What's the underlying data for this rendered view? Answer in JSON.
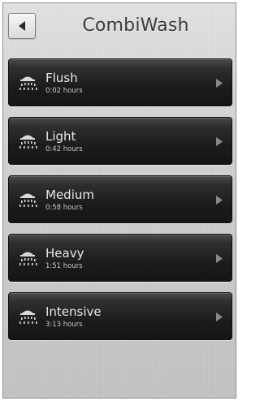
{
  "header": {
    "title": "CombiWash",
    "back_icon": "back-arrow-icon"
  },
  "programs": [
    {
      "label": "Flush",
      "duration": "0:02 hours",
      "icon": "shower-icon"
    },
    {
      "label": "Light",
      "duration": "0:42 hours",
      "icon": "shower-icon"
    },
    {
      "label": "Medium",
      "duration": "0:58 hours",
      "icon": "shower-icon"
    },
    {
      "label": "Heavy",
      "duration": "1:51 hours",
      "icon": "shower-icon"
    },
    {
      "label": "Intensive",
      "duration": "3:13 hours",
      "icon": "shower-icon"
    }
  ],
  "colors": {
    "row_bg": "#1c1c1c",
    "row_text": "#e8e8e8",
    "title_text": "#3a3a3a",
    "background": "#cfcfcf"
  }
}
